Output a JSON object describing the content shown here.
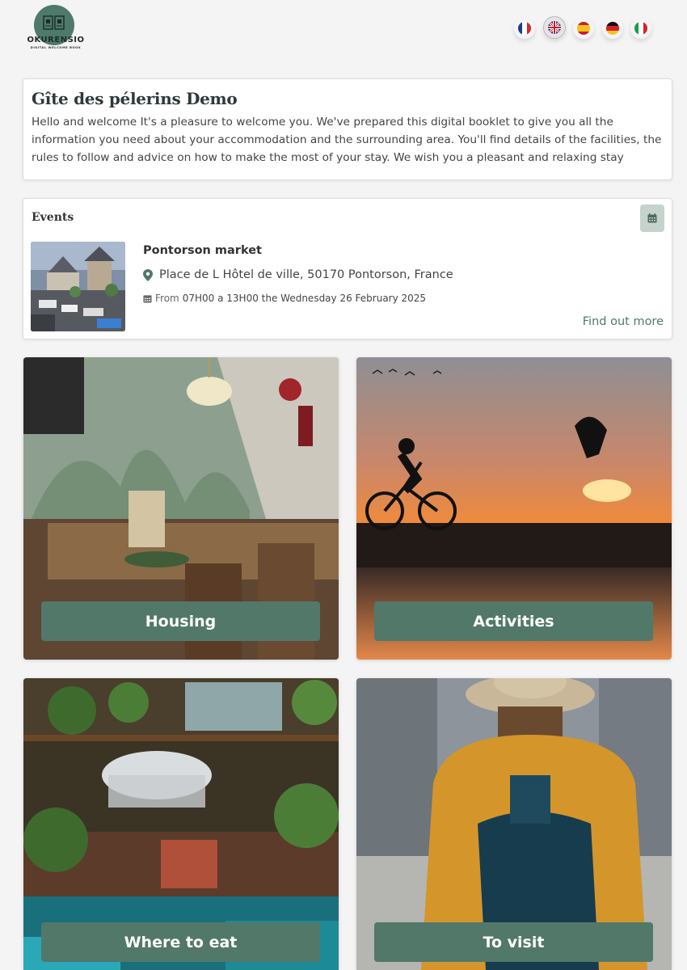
{
  "header": {
    "brand_name": "OKURENSIO",
    "brand_tagline": "DIGITAL WELCOME BOOK",
    "languages": [
      {
        "code": "fr",
        "active": false
      },
      {
        "code": "en",
        "active": true
      },
      {
        "code": "es",
        "active": false
      },
      {
        "code": "de",
        "active": false
      },
      {
        "code": "it",
        "active": false
      }
    ]
  },
  "welcome": {
    "title": "Gîte des pélerins Demo",
    "text": "Hello and welcome It's a pleasure to welcome you. We've prepared this digital booklet to give you all the information you need about your accommodation and the surrounding area. You'll find details of the facilities, the rules to follow and advice on how to make the most of your stay. We wish you a pleasant and relaxing stay"
  },
  "events": {
    "title": "Events",
    "item": {
      "name": "Pontorson market",
      "address": "Place de L Hôtel de ville, 50170 Pontorson, France",
      "from_label": "From",
      "schedule": "07H00 a 13H00 the Wednesday 26 February 2025"
    },
    "more_label": "Find out more"
  },
  "tiles": [
    {
      "label": "Housing"
    },
    {
      "label": "Activities"
    },
    {
      "label": "Where to eat"
    },
    {
      "label": "To visit"
    }
  ],
  "colors": {
    "accent": "#52786a",
    "calendar_button": "#c4d4cc",
    "link": "#4e7a6a"
  }
}
